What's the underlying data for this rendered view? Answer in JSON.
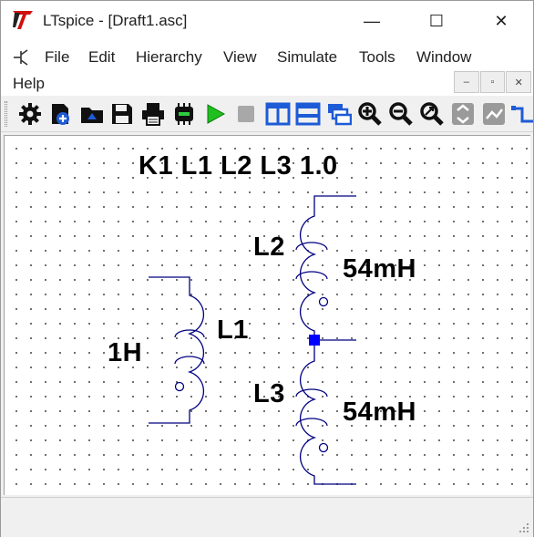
{
  "window": {
    "title": "LTspice - [Draft1.asc]",
    "controls": {
      "minimize": "—",
      "maximize": "☐",
      "close": "✕"
    }
  },
  "menu": {
    "items": [
      "File",
      "Edit",
      "Hierarchy",
      "View",
      "Simulate",
      "Tools",
      "Window",
      "Help"
    ],
    "mdi": {
      "minimize": "–",
      "restore": "▫",
      "close": "✕"
    }
  },
  "toolbar": {
    "buttons": [
      "gear-icon",
      "new-schematic-icon",
      "open-icon",
      "save-icon",
      "print-icon",
      "component-icon",
      "run-icon",
      "stop-icon",
      "tile-vertical-icon",
      "tile-horizontal-icon",
      "cascade-icon",
      "zoom-in-icon",
      "zoom-out-icon",
      "zoom-fit-icon",
      "autoscale-icon",
      "toggle-icon",
      "wire-icon"
    ]
  },
  "schematic": {
    "directive": "K1 L1 L2 L3 1.0",
    "components": [
      {
        "name": "L1",
        "value": "1H"
      },
      {
        "name": "L2",
        "value": "54mH"
      },
      {
        "name": "L3",
        "value": "54mH"
      }
    ],
    "colors": {
      "wire": "#000080",
      "junction": "#0000ff",
      "text": "#000000",
      "grid": "#5a5a5a"
    }
  }
}
